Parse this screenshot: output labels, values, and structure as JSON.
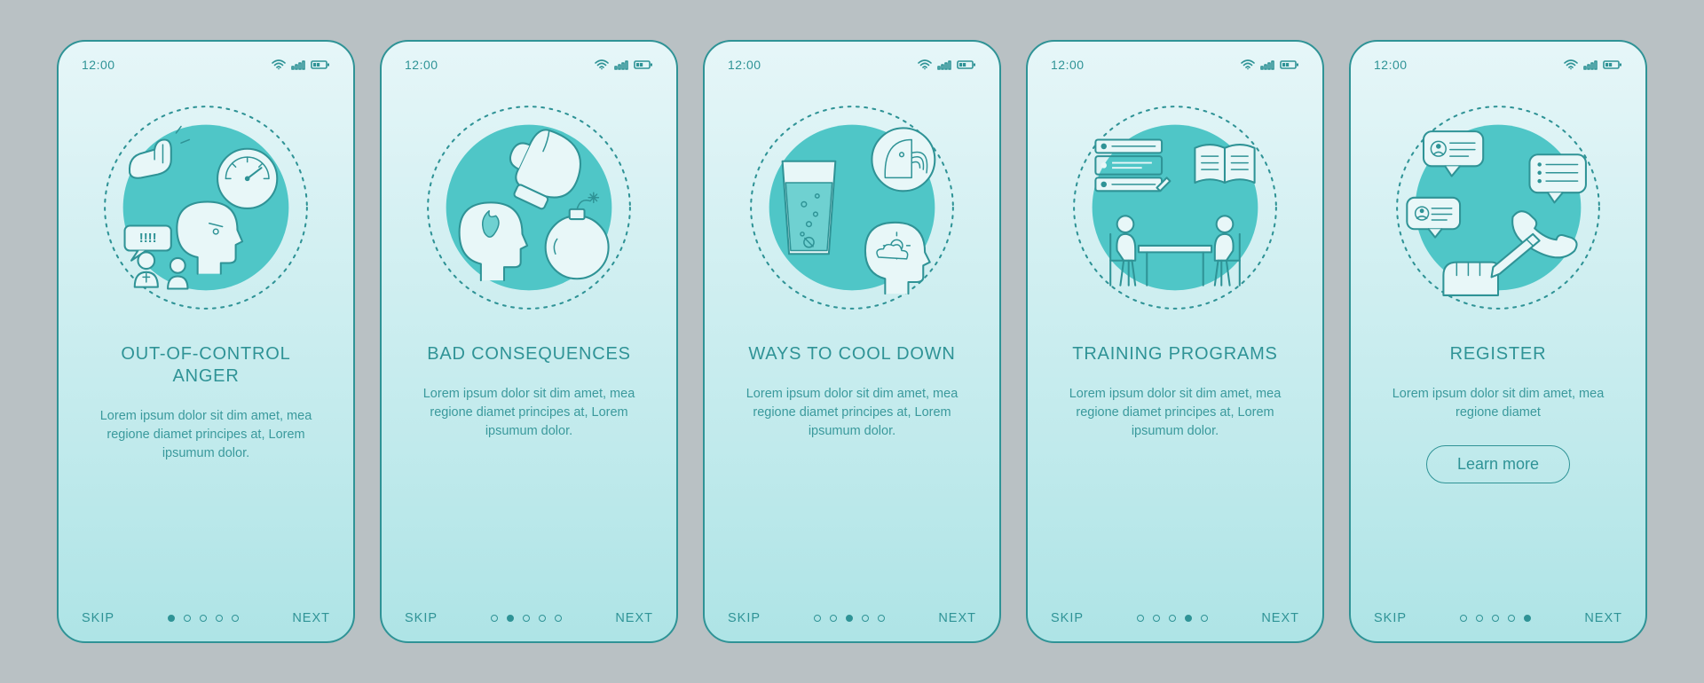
{
  "status": {
    "time": "12:00"
  },
  "common": {
    "skip": "SKIP",
    "next": "NEXT"
  },
  "screens": [
    {
      "title": "Out-of-control anger",
      "body": "Lorem ipsum dolor sit dim amet, mea regione diamet principes at, Lorem ipsumum dolor.",
      "activeDot": 0
    },
    {
      "title": "Bad consequences",
      "body": "Lorem ipsum dolor sit dim amet, mea regione diamet principes at, Lorem ipsumum dolor.",
      "activeDot": 1
    },
    {
      "title": "Ways to cool down",
      "body": "Lorem ipsum dolor sit dim amet, mea regione diamet principes at, Lorem ipsumum dolor.",
      "activeDot": 2
    },
    {
      "title": "Training programs",
      "body": "Lorem ipsum dolor sit dim amet, mea regione diamet principes at, Lorem ipsumum dolor.",
      "activeDot": 3
    },
    {
      "title": "Register",
      "body": "Lorem ipsum dolor sit dim amet, mea regione diamet",
      "cta": "Learn more",
      "activeDot": 4
    }
  ]
}
